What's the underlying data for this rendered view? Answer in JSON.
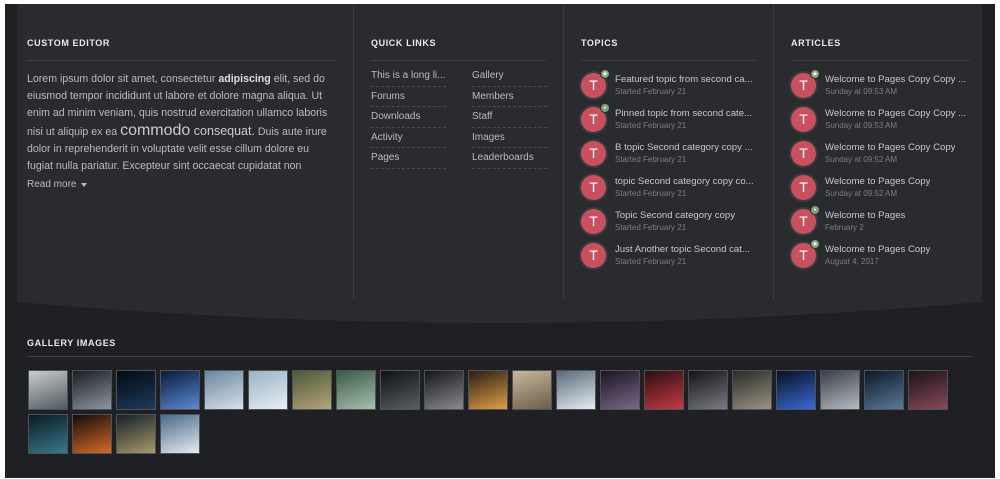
{
  "custom_editor": {
    "title": "CUSTOM EDITOR",
    "p1_a": "Lorem ipsum dolor sit amet, consectetur ",
    "p1_b": "adipiscing",
    "p1_c": " elit, sed do eiusmod tempor incididunt ut labore et dolore magna aliqua. Ut enim ad minim veniam, quis nostrud exercitation ullamco laboris",
    "p2_a": "nisi ut aliquip ex ea ",
    "p2_b": "commodo",
    "p2_c": " consequat.",
    "p2_d": " Duis aute irure dolor in reprehenderit in voluptate velit esse cillum dolore eu fugiat nulla pariatur. Excepteur sint occaecat cupidatat non",
    "read_more": "Read more"
  },
  "quick_links": {
    "title": "QUICK LINKS",
    "links": [
      "This is a long li...",
      "Gallery",
      "Forums",
      "Members",
      "Downloads",
      "Staff",
      "Activity",
      "Images",
      "Pages",
      "Leaderboards"
    ]
  },
  "topics": {
    "title": "TOPICS",
    "items": [
      {
        "avatar": "T",
        "title": "Featured topic from second ca...",
        "date": "Started February 21",
        "badge": "★"
      },
      {
        "avatar": "T",
        "title": "Pinned topic from second cate...",
        "date": "Started February 21",
        "badge": "📌"
      },
      {
        "avatar": "T",
        "title": "B topic Second category copy ...",
        "date": "Started February 21",
        "badge": ""
      },
      {
        "avatar": "T",
        "title": "topic Second category copy co...",
        "date": "Started February 21",
        "badge": ""
      },
      {
        "avatar": "T",
        "title": "Topic Second category copy",
        "date": "Started February 21",
        "badge": ""
      },
      {
        "avatar": "T",
        "title": "Just Another topic Second cat...",
        "date": "Started February 21",
        "badge": ""
      }
    ]
  },
  "articles": {
    "title": "ARTICLES",
    "items": [
      {
        "avatar": "T",
        "title": "Welcome to Pages Copy Copy ...",
        "date": "Sunday at 09:53 AM",
        "badge": "★"
      },
      {
        "avatar": "T",
        "title": "Welcome to Pages Copy Copy ...",
        "date": "Sunday at 09:53 AM",
        "badge": ""
      },
      {
        "avatar": "T",
        "title": "Welcome to Pages Copy Copy",
        "date": "Sunday at 09:52 AM",
        "badge": ""
      },
      {
        "avatar": "T",
        "title": "Welcome to Pages Copy",
        "date": "Sunday at 09:52 AM",
        "badge": ""
      },
      {
        "avatar": "T",
        "title": "Welcome to Pages",
        "date": "February 2",
        "badge": "📌"
      },
      {
        "avatar": "T",
        "title": "Welcome to Pages Copy",
        "date": "August 4, 2017",
        "badge": "★"
      }
    ]
  },
  "gallery": {
    "title": "GALLERY IMAGES",
    "images": [
      {
        "name": "misty-landscape",
        "colors": [
          "#c9cdd0",
          "#4e5a5e"
        ]
      },
      {
        "name": "dark-mountain",
        "colors": [
          "#1a1e24",
          "#8a97a0"
        ]
      },
      {
        "name": "night-city",
        "colors": [
          "#050a12",
          "#1e3a5c"
        ]
      },
      {
        "name": "blue-planet",
        "colors": [
          "#0a1a3a",
          "#5a8ad8"
        ]
      },
      {
        "name": "snowy-village",
        "colors": [
          "#6c86a0",
          "#d6e0ea"
        ]
      },
      {
        "name": "winter-peaks",
        "colors": [
          "#9ab2c6",
          "#e8eef2"
        ]
      },
      {
        "name": "mossy-ruins",
        "colors": [
          "#4a5a3a",
          "#b6a47a"
        ]
      },
      {
        "name": "green-valley",
        "colors": [
          "#3a5a48",
          "#a8c0b0"
        ]
      },
      {
        "name": "dark-figure",
        "colors": [
          "#0e1014",
          "#5a6066"
        ]
      },
      {
        "name": "rock-arch",
        "colors": [
          "#14161a",
          "#8a8c90"
        ]
      },
      {
        "name": "sunset-battle",
        "colors": [
          "#2a1e14",
          "#e0a048"
        ]
      },
      {
        "name": "beige-desert",
        "colors": [
          "#c8b89a",
          "#6a5e4a"
        ]
      },
      {
        "name": "mountain-pass",
        "colors": [
          "#5a6a7a",
          "#e6ecf0"
        ]
      },
      {
        "name": "purple-city",
        "colors": [
          "#1a1424",
          "#7a6a8a"
        ]
      },
      {
        "name": "red-market",
        "colors": [
          "#2a0e12",
          "#c83a44"
        ]
      },
      {
        "name": "dark-castle",
        "colors": [
          "#141418",
          "#7a7c82"
        ]
      },
      {
        "name": "ruined-temple",
        "colors": [
          "#2a2a28",
          "#9a9484"
        ]
      },
      {
        "name": "blue-crystal",
        "colors": [
          "#081020",
          "#3a6ad8"
        ]
      },
      {
        "name": "grey-towers",
        "colors": [
          "#3a4048",
          "#b6bcc4"
        ]
      },
      {
        "name": "storm-giant",
        "colors": [
          "#0c1828",
          "#5a7a9a"
        ]
      },
      {
        "name": "crimson-spires",
        "colors": [
          "#1a1218",
          "#8a4a5a"
        ]
      },
      {
        "name": "teal-beast",
        "colors": [
          "#0a1a22",
          "#3a7a8a"
        ]
      },
      {
        "name": "lantern-bokeh",
        "colors": [
          "#120c0a",
          "#d86a2a"
        ]
      },
      {
        "name": "dragon-sky",
        "colors": [
          "#14202a",
          "#a89a6a"
        ]
      },
      {
        "name": "alpine-lake",
        "colors": [
          "#4a6a8a",
          "#e4eaf0"
        ]
      }
    ]
  }
}
